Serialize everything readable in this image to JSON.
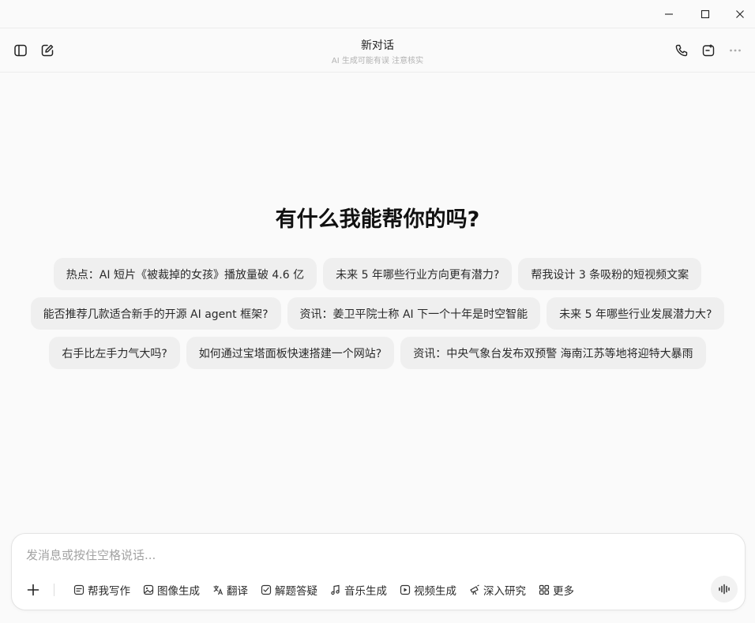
{
  "window": {
    "minimize_icon": "minimize-icon",
    "maximize_icon": "maximize-icon",
    "close_icon": "close-icon"
  },
  "header": {
    "title": "新对话",
    "subtitle": "AI 生成可能有误 注意核实",
    "left_icons": [
      "sidebar-toggle-icon",
      "new-chat-icon"
    ],
    "right_icons": [
      "phone-icon",
      "share-icon",
      "more-icon"
    ]
  },
  "main": {
    "greeting": "有什么我能帮你的吗?",
    "suggestions": [
      [
        "热点：AI 短片《被裁掉的女孩》播放量破 4.6 亿",
        "未来 5 年哪些行业方向更有潜力?",
        "帮我设计 3 条吸粉的短视频文案"
      ],
      [
        "能否推荐几款适合新手的开源 AI agent 框架?",
        "资讯：姜卫平院士称 AI 下一个十年是时空智能",
        "未来 5 年哪些行业发展潜力大?"
      ],
      [
        "右手比左手力气大吗?",
        "如何通过宝塔面板快速搭建一个网站?",
        "资讯：中央气象台发布双预警 海南江苏等地将迎特大暴雨"
      ]
    ]
  },
  "composer": {
    "placeholder": "发消息或按住空格说话...",
    "value": "",
    "tools": [
      {
        "label": "帮我写作",
        "icon": "writing-icon"
      },
      {
        "label": "图像生成",
        "icon": "image-icon"
      },
      {
        "label": "翻译",
        "icon": "translate-icon"
      },
      {
        "label": "解题答疑",
        "icon": "solve-icon"
      },
      {
        "label": "音乐生成",
        "icon": "music-icon"
      },
      {
        "label": "视频生成",
        "icon": "video-icon"
      },
      {
        "label": "深入研究",
        "icon": "research-icon"
      },
      {
        "label": "更多",
        "icon": "grid-icon"
      }
    ],
    "voice_icon": "voice-wave-icon",
    "plus_icon": "plus-icon"
  }
}
